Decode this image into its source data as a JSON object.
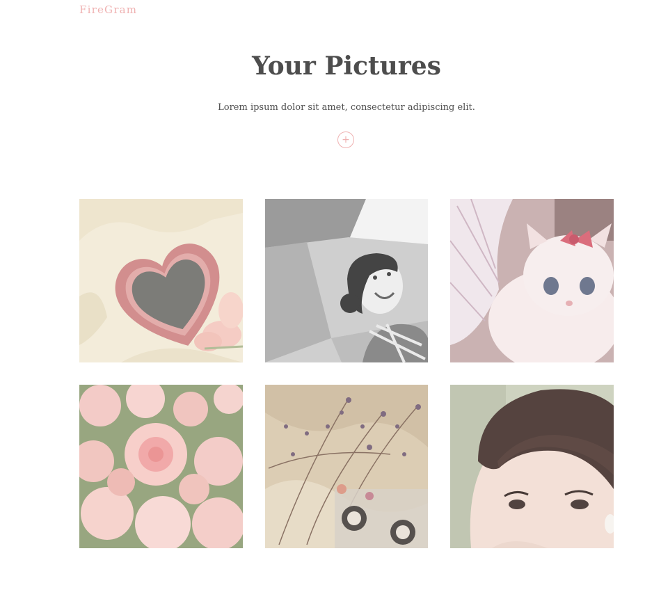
{
  "brand": {
    "name": "FireGram"
  },
  "header": {
    "title": "Your Pictures",
    "subtitle": "Lorem ipsum dolor sit amet, consectetur adipiscing elit."
  },
  "upload": {
    "label": "+"
  },
  "colors": {
    "accent": "#efb1b1",
    "text": "#4d4d4d",
    "background": "#ffffff"
  },
  "gallery": {
    "images": [
      {
        "subject": "pink heart-shaped mirror with tulips"
      },
      {
        "subject": "black and white portrait of smiling woman"
      },
      {
        "subject": "white kitten with pink bow and fairy wings"
      },
      {
        "subject": "pale pink roses"
      },
      {
        "subject": "dried flowers and cassette tape"
      },
      {
        "subject": "vintage close-up portrait of woman with bangs"
      }
    ]
  }
}
